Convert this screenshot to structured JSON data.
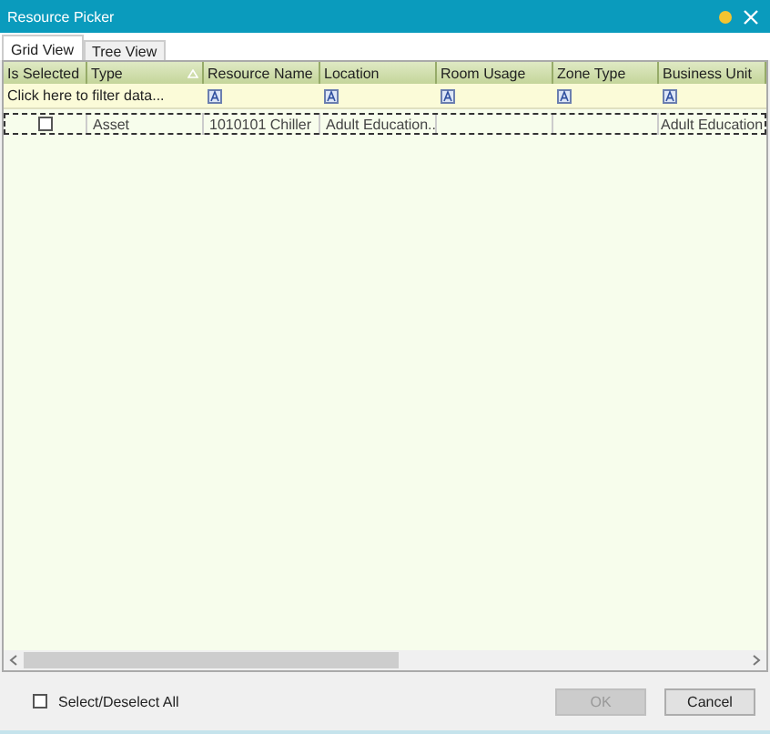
{
  "window": {
    "title": "Resource Picker"
  },
  "tabs": [
    {
      "label": "Grid View",
      "selected": true
    },
    {
      "label": "Tree View",
      "selected": false
    }
  ],
  "table": {
    "columns": [
      {
        "label": "Is Selected",
        "sorted": false
      },
      {
        "label": "Type",
        "sorted": true
      },
      {
        "label": "Resource Name",
        "sorted": false,
        "filter": true
      },
      {
        "label": "Location",
        "sorted": false,
        "filter": true
      },
      {
        "label": "Room Usage",
        "sorted": false,
        "filter": true
      },
      {
        "label": "Zone Type",
        "sorted": false,
        "filter": true
      },
      {
        "label": "Business Unit",
        "sorted": false,
        "filter": true
      }
    ],
    "filter_hint": "Click here to filter data...",
    "rows": [
      {
        "checked": false,
        "selected": true,
        "cells": [
          "",
          "Asset",
          "1010101 Chiller",
          "Adult Education..",
          "",
          "",
          "Adult Education"
        ]
      }
    ]
  },
  "select_all": {
    "label": "Select/Deselect All",
    "checked": false
  },
  "buttons": [
    {
      "label": "OK",
      "disabled": true
    },
    {
      "label": "Cancel",
      "disabled": false
    }
  ]
}
